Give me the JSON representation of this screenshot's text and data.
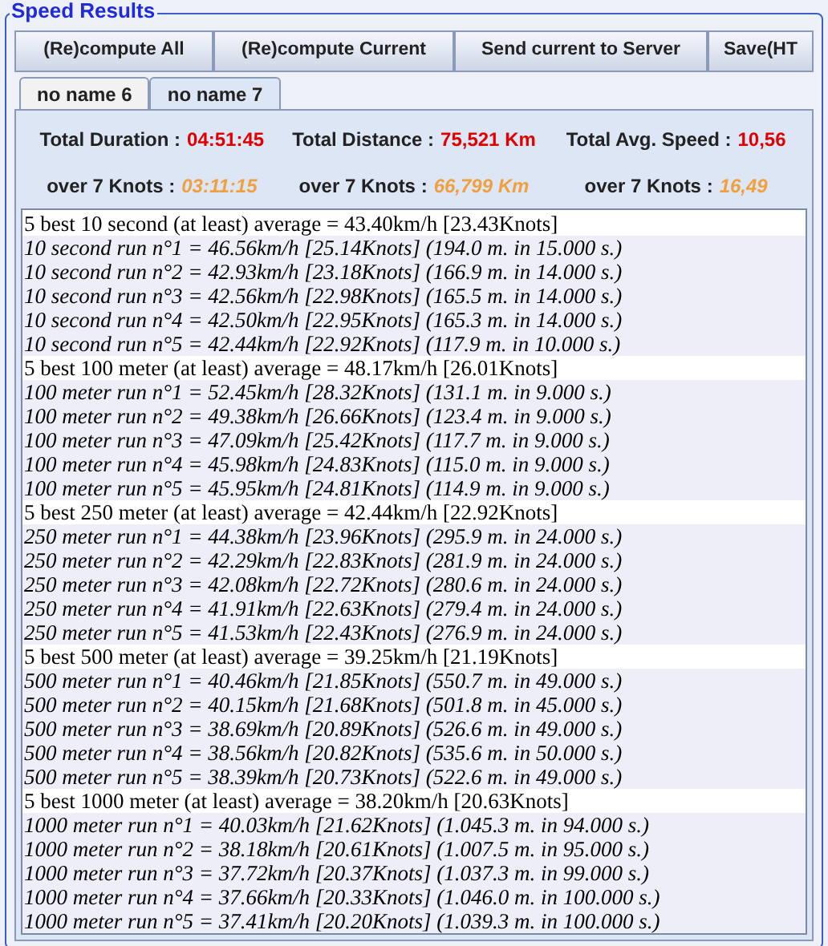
{
  "panel": {
    "title": "Speed Results"
  },
  "buttons": [
    "(Re)compute All",
    "(Re)compute Current",
    "Send current to Server",
    "Save(HT"
  ],
  "tabs": [
    {
      "label": "no name 6",
      "selected": false
    },
    {
      "label": "no name 7",
      "selected": true
    }
  ],
  "totals": [
    {
      "label": "Total Duration :",
      "value": "04:51:45"
    },
    {
      "label": "Total Distance :",
      "value": "75,521 Km"
    },
    {
      "label": "Total Avg. Speed :",
      "value": "10,56"
    }
  ],
  "over": [
    {
      "label": "over  7 Knots :",
      "value": "03:11:15"
    },
    {
      "label": "over  7 Knots :",
      "value": "66,799 Km"
    },
    {
      "label": "over  7 Knots :",
      "value": "16,49"
    }
  ],
  "results": [
    {
      "kind": "header",
      "text": "5 best 10 second (at least) average = 43.40km/h [23.43Knots]"
    },
    {
      "kind": "run",
      "text": "10 second run n°1 = 46.56km/h [25.14Knots] (194.0 m. in 15.000 s.)"
    },
    {
      "kind": "run",
      "text": "10 second run n°2 = 42.93km/h [23.18Knots] (166.9 m. in 14.000 s.)"
    },
    {
      "kind": "run",
      "text": "10 second run n°3 = 42.56km/h [22.98Knots] (165.5 m. in 14.000 s.)"
    },
    {
      "kind": "run",
      "text": "10 second run n°4 = 42.50km/h [22.95Knots] (165.3 m. in 14.000 s.)"
    },
    {
      "kind": "run",
      "text": "10 second run n°5 = 42.44km/h [22.92Knots] (117.9 m. in 10.000 s.)"
    },
    {
      "kind": "header",
      "text": "5 best 100 meter (at least) average = 48.17km/h [26.01Knots]"
    },
    {
      "kind": "run",
      "text": "100 meter run n°1 = 52.45km/h [28.32Knots] (131.1 m. in 9.000 s.)"
    },
    {
      "kind": "run",
      "text": "100 meter run n°2 = 49.38km/h [26.66Knots] (123.4 m. in 9.000 s.)"
    },
    {
      "kind": "run",
      "text": "100 meter run n°3 = 47.09km/h [25.42Knots] (117.7 m. in 9.000 s.)"
    },
    {
      "kind": "run",
      "text": "100 meter run n°4 = 45.98km/h [24.83Knots] (115.0 m. in 9.000 s.)"
    },
    {
      "kind": "run",
      "text": "100 meter run n°5 = 45.95km/h [24.81Knots] (114.9 m. in 9.000 s.)"
    },
    {
      "kind": "header",
      "text": "5 best 250 meter (at least) average = 42.44km/h [22.92Knots]"
    },
    {
      "kind": "run",
      "text": "250 meter run n°1 = 44.38km/h [23.96Knots] (295.9 m. in 24.000 s.)"
    },
    {
      "kind": "run",
      "text": "250 meter run n°2 = 42.29km/h [22.83Knots] (281.9 m. in 24.000 s.)"
    },
    {
      "kind": "run",
      "text": "250 meter run n°3 = 42.08km/h [22.72Knots] (280.6 m. in 24.000 s.)"
    },
    {
      "kind": "run",
      "text": "250 meter run n°4 = 41.91km/h [22.63Knots] (279.4 m. in 24.000 s.)"
    },
    {
      "kind": "run",
      "text": "250 meter run n°5 = 41.53km/h [22.43Knots] (276.9 m. in 24.000 s.)"
    },
    {
      "kind": "header",
      "text": "5 best 500 meter (at least) average = 39.25km/h [21.19Knots]"
    },
    {
      "kind": "run",
      "text": "500 meter run n°1 = 40.46km/h [21.85Knots] (550.7 m. in 49.000 s.)"
    },
    {
      "kind": "run",
      "text": "500 meter run n°2 = 40.15km/h [21.68Knots] (501.8 m. in 45.000 s.)"
    },
    {
      "kind": "run",
      "text": "500 meter run n°3 = 38.69km/h [20.89Knots] (526.6 m. in 49.000 s.)"
    },
    {
      "kind": "run",
      "text": "500 meter run n°4 = 38.56km/h [20.82Knots] (535.6 m. in 50.000 s.)"
    },
    {
      "kind": "run",
      "text": "500 meter run n°5 = 38.39km/h [20.73Knots] (522.6 m. in 49.000 s.)"
    },
    {
      "kind": "header",
      "text": "5 best 1000 meter (at least) average = 38.20km/h [20.63Knots]"
    },
    {
      "kind": "run",
      "text": "1000 meter run n°1 = 40.03km/h [21.62Knots] (1.045.3 m. in 94.000 s.)"
    },
    {
      "kind": "run",
      "text": "1000 meter run n°2 = 38.18km/h [20.61Knots] (1.007.5 m. in 95.000 s.)"
    },
    {
      "kind": "run",
      "text": "1000 meter run n°3 = 37.72km/h [20.37Knots] (1.037.3 m. in 99.000 s.)"
    },
    {
      "kind": "run",
      "text": "1000 meter run n°4 = 37.66km/h [20.33Knots] (1.046.0 m. in 100.000 s.)"
    },
    {
      "kind": "run",
      "text": "1000 meter run n°5 = 37.41km/h [20.20Knots] (1.039.3 m. in 100.000 s.)"
    }
  ]
}
